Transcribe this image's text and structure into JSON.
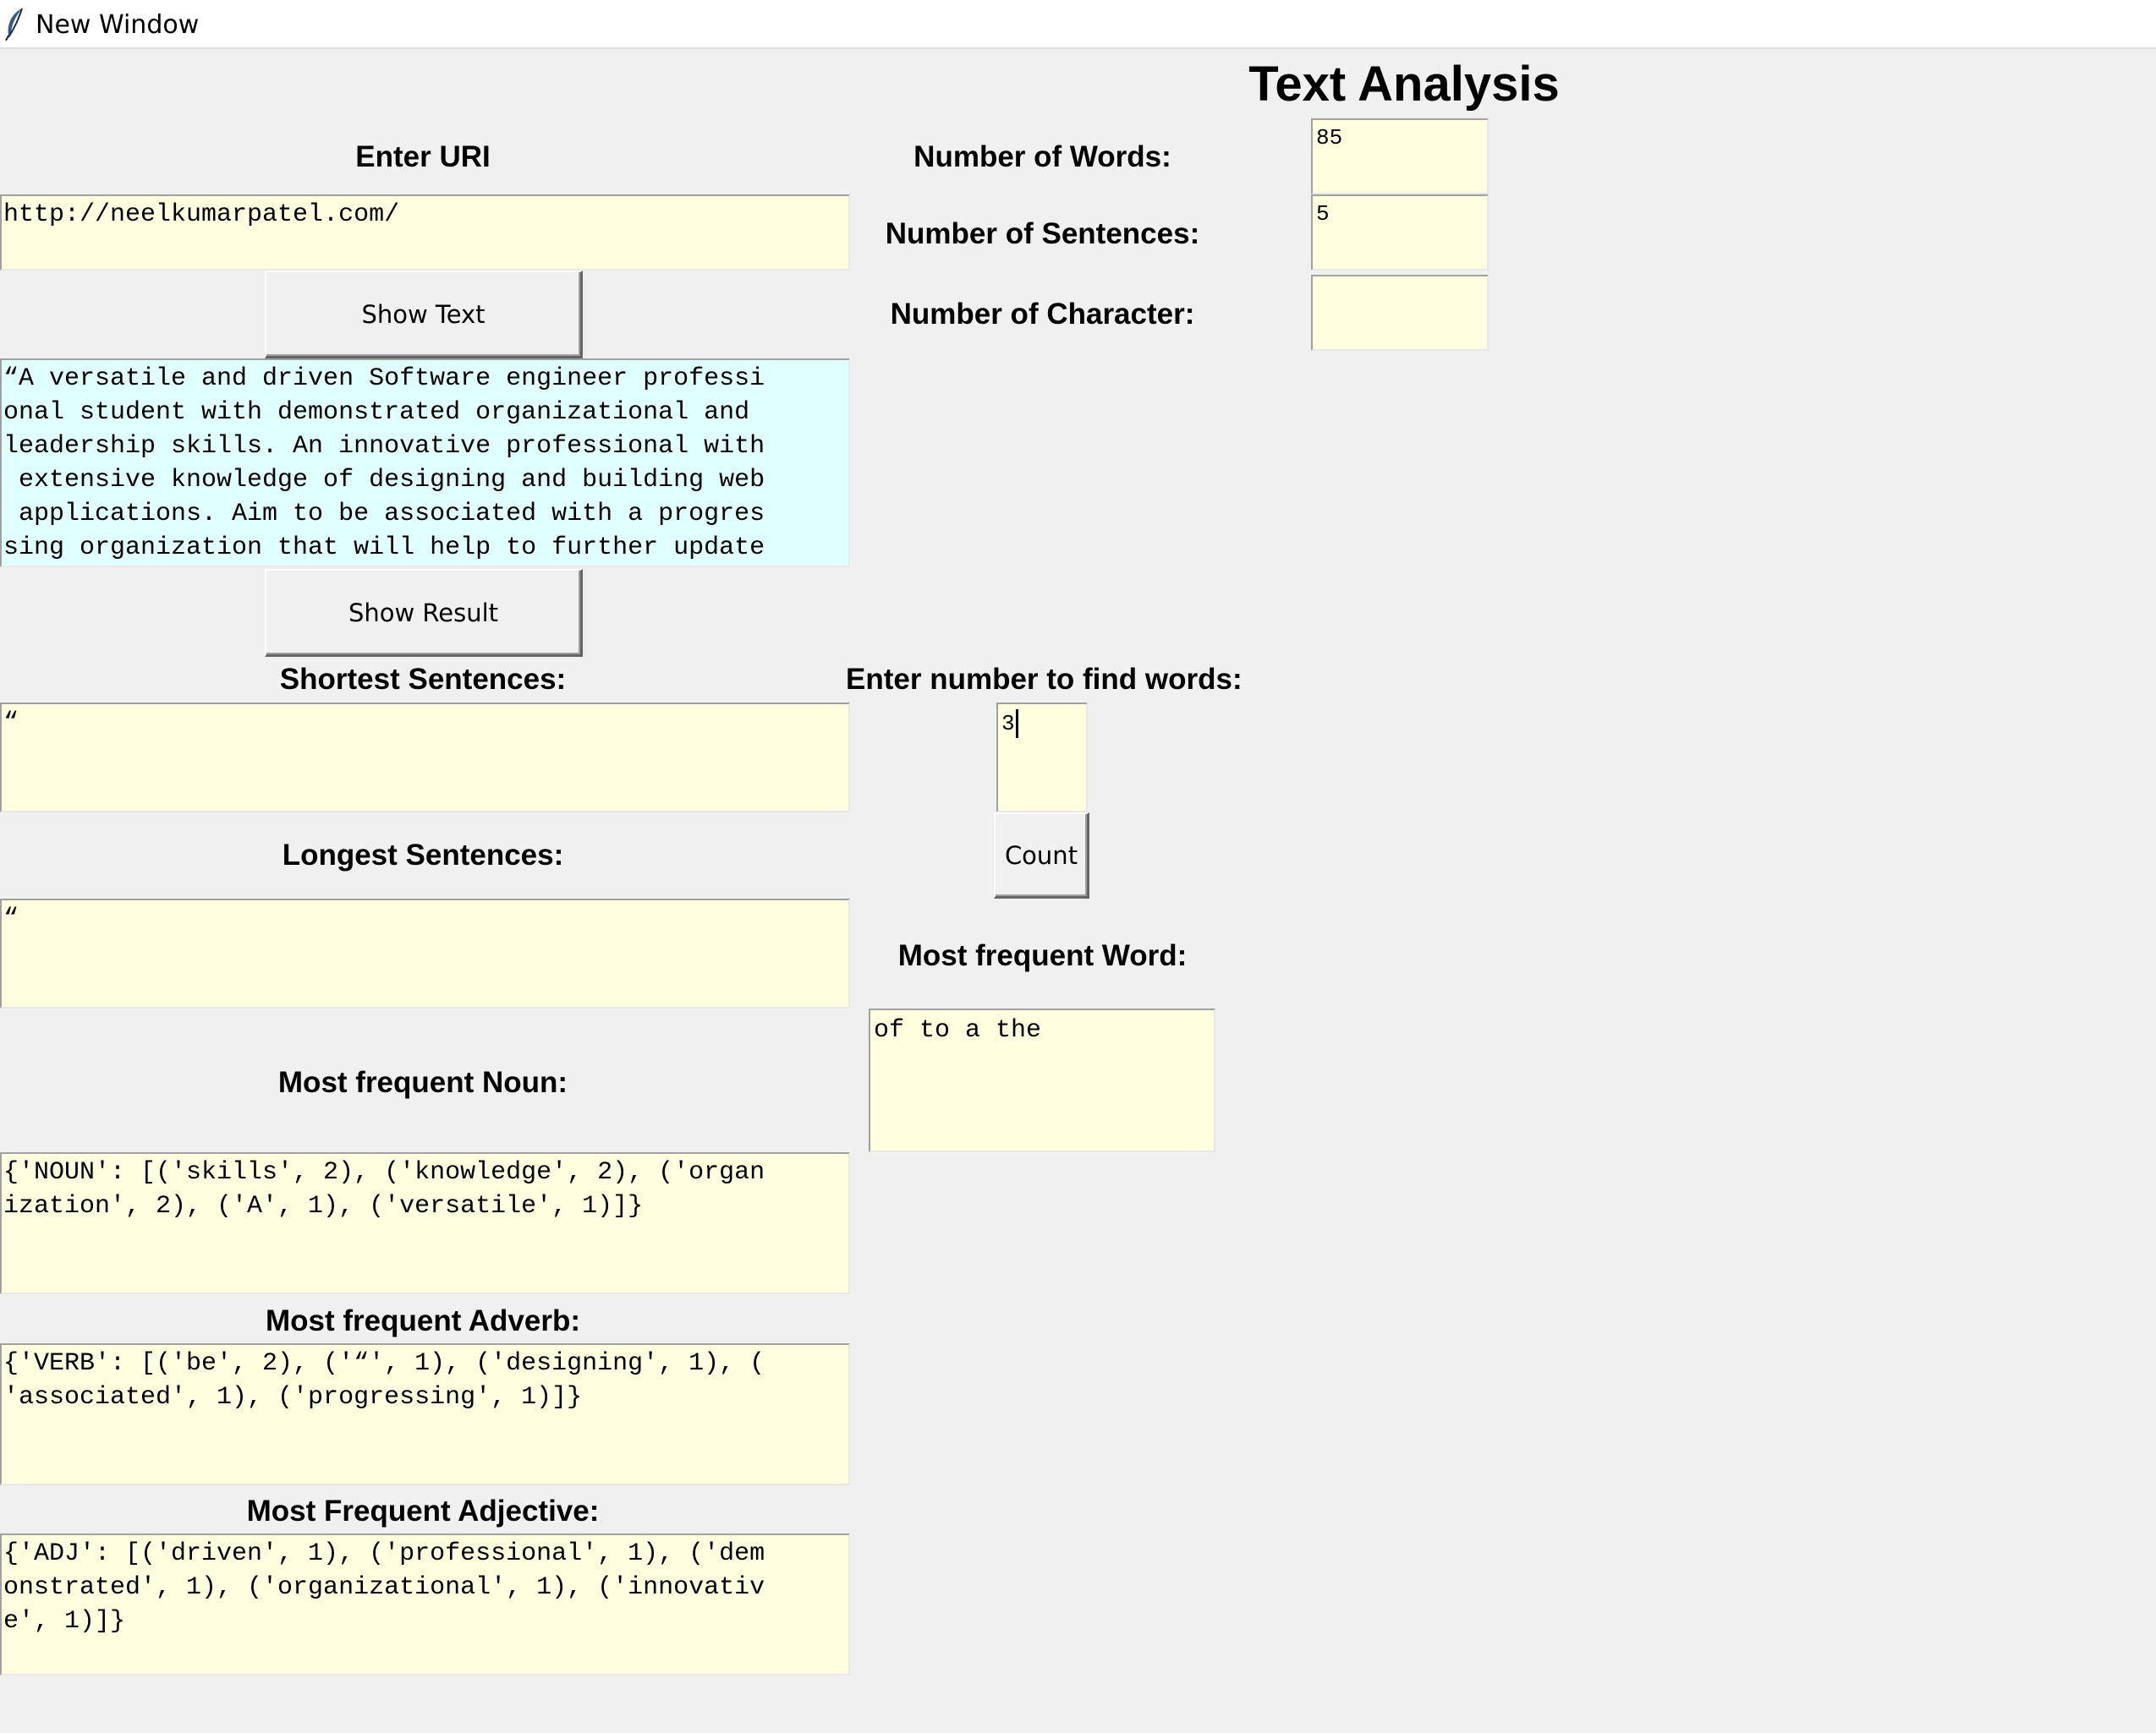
{
  "window": {
    "title": "New Window"
  },
  "app": {
    "title": "Text Analysis"
  },
  "uri": {
    "label": "Enter URI",
    "value": "http://neelkumarpatel.com/"
  },
  "buttons": {
    "show_text": "Show Text",
    "show_result": "Show Result",
    "count": "Count"
  },
  "text_output": {
    "lines": [
      "“A versatile and driven Software engineer professi",
      "onal student with demonstrated organizational and ",
      "leadership skills. An innovative professional with",
      " extensive knowledge of designing and building web",
      " applications. Aim to be associated with a progres",
      "sing organization that will help to further update"
    ]
  },
  "stats": {
    "words_label": "Number of Words:",
    "words_value": "85",
    "sentences_label": "Number of Sentences:",
    "sentences_value": "5",
    "characters_label": "Number of Character:",
    "characters_value": ""
  },
  "shortest": {
    "label": "Shortest Sentences:",
    "value": "“"
  },
  "longest": {
    "label": "Longest Sentences:",
    "value": "“"
  },
  "find_words": {
    "label": "Enter number to find words:",
    "value": "3"
  },
  "frequent_word": {
    "label": "Most frequent Word:",
    "value": "of to a the"
  },
  "noun": {
    "label": "Most frequent Noun:",
    "lines": [
      "{'NOUN': [('skills', 2), ('knowledge', 2), ('organ",
      "ization', 2), ('A', 1), ('versatile', 1)]}"
    ]
  },
  "adverb": {
    "label": "Most frequent Adverb:",
    "lines": [
      "{'VERB': [('be', 2), ('“', 1), ('designing', 1), (",
      "'associated', 1), ('progressing', 1)]}"
    ]
  },
  "adjective": {
    "label": "Most Frequent Adjective:",
    "lines": [
      "{'ADJ': [('driven', 1), ('professional', 1), ('dem",
      "onstrated', 1), ('organizational', 1), ('innovativ",
      "e', 1)]}"
    ]
  },
  "colors": {
    "entry_bg": "#ffffe0",
    "text_bg": "#e0ffff",
    "window_bg": "#f0f0f0"
  },
  "icons": {
    "titlebar": "feather-icon"
  }
}
